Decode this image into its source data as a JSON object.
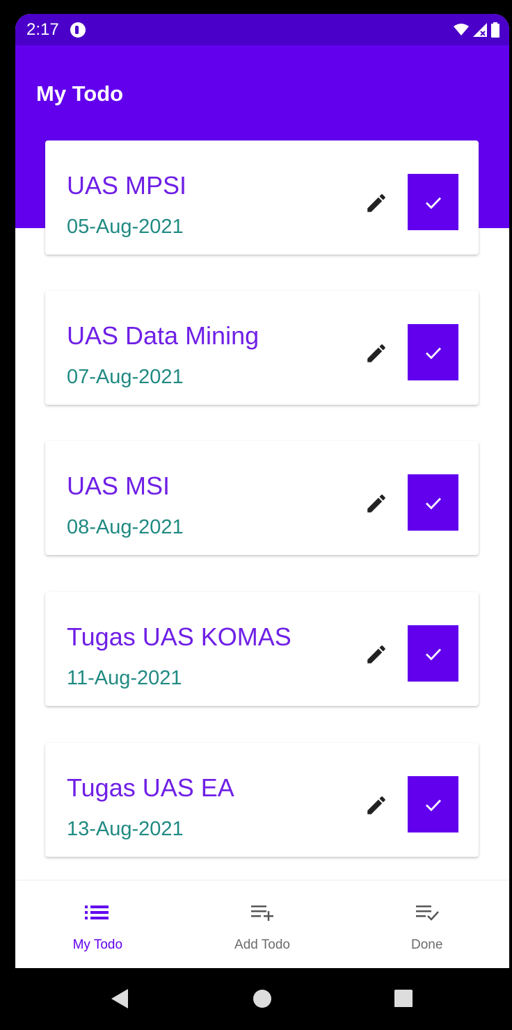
{
  "status_bar": {
    "time": "2:17"
  },
  "app_bar": {
    "title": "My Todo"
  },
  "todos": [
    {
      "title": "UAS MPSI",
      "date": "05-Aug-2021"
    },
    {
      "title": "UAS Data Mining",
      "date": "07-Aug-2021"
    },
    {
      "title": "UAS MSI",
      "date": "08-Aug-2021"
    },
    {
      "title": "Tugas UAS KOMAS",
      "date": "11-Aug-2021"
    },
    {
      "title": "Tugas UAS EA",
      "date": "13-Aug-2021"
    }
  ],
  "bottom_nav": {
    "items": [
      {
        "label": "My Todo",
        "icon": "list-icon",
        "active": true
      },
      {
        "label": "Add Todo",
        "icon": "playlist-add-icon",
        "active": false
      },
      {
        "label": "Done",
        "icon": "playlist-check-icon",
        "active": false
      }
    ]
  },
  "system_nav": {
    "buttons": [
      "back-icon",
      "home-icon",
      "recents-icon"
    ]
  },
  "colors": {
    "primary": "#6200ee",
    "status_bar": "#4a00c8",
    "todo_title": "#6f1fe6",
    "todo_date": "#208a82"
  }
}
